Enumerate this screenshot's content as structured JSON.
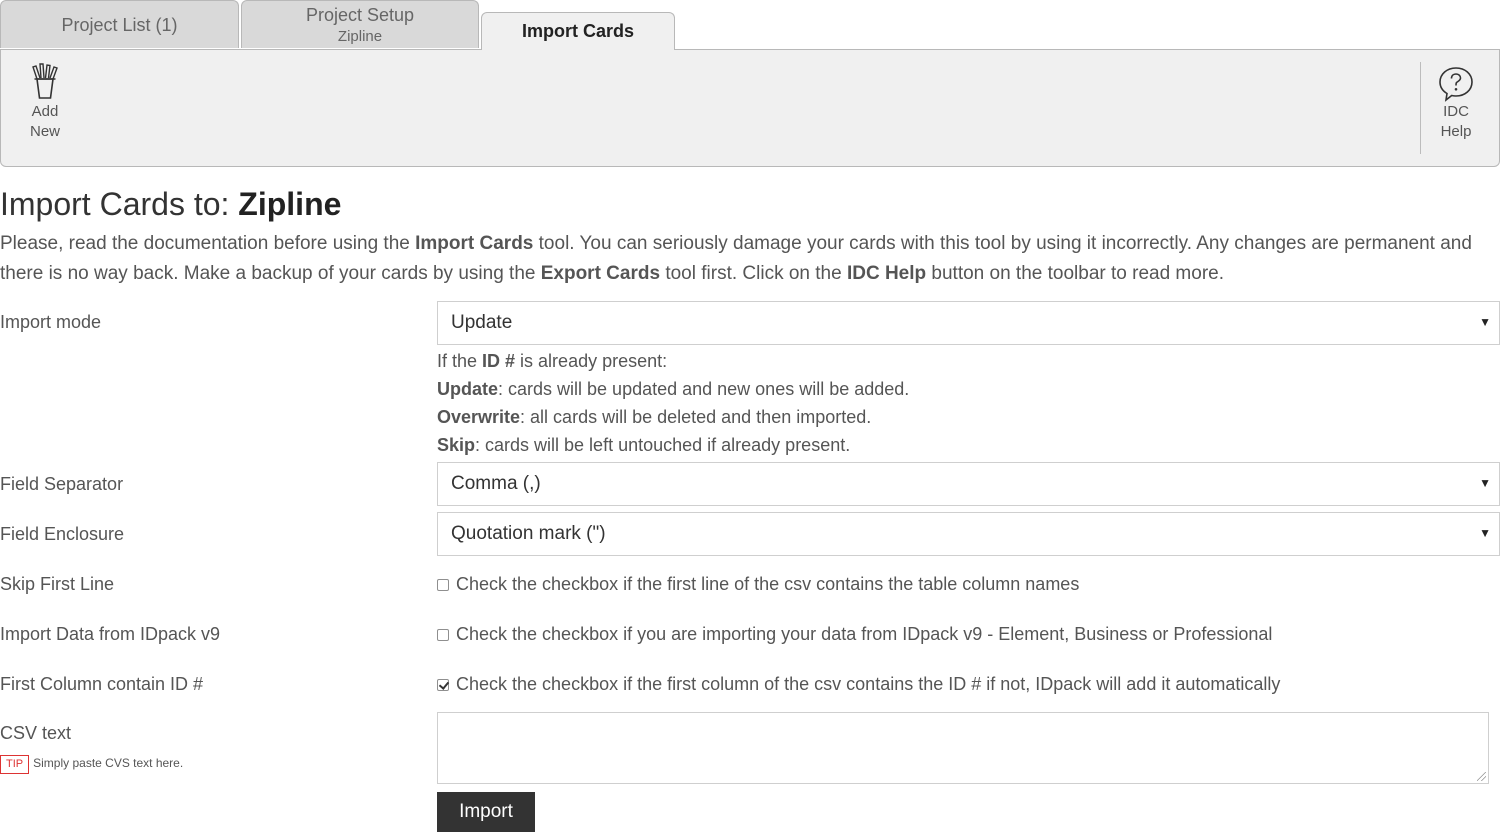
{
  "tabs": [
    {
      "label": "Project List (1)"
    },
    {
      "label": "Project Setup",
      "sublabel": "Zipline"
    },
    {
      "label": "Import Cards"
    }
  ],
  "toolbar": {
    "add_new": {
      "line1": "Add",
      "line2": "New",
      "icon": "pencil-cup-icon"
    },
    "idc_help": {
      "line1": "IDC",
      "line2": "Help",
      "icon": "question-bubble-icon"
    }
  },
  "page": {
    "title_prefix": "Import Cards to: ",
    "project_name": "Zipline",
    "intro": {
      "p1": "Please, read the documentation before using the ",
      "b1": "Import Cards",
      "p2": " tool. You can seriously damage your cards with this tool by using it incorrectly. Any changes are permanent and there is no way back. Make a backup of your cards by using the ",
      "b2": "Export Cards",
      "p3": " tool first. Click on the ",
      "b3": "IDC Help",
      "p4": " button on the toolbar to read more."
    }
  },
  "form": {
    "import_mode": {
      "label": "Import mode",
      "value": "Update",
      "help": {
        "intro_pre": "If the ",
        "intro_b": "ID #",
        "intro_post": " is already present:",
        "update_b": "Update",
        "update_t": ": cards will be updated and new ones will be added.",
        "overwrite_b": "Overwrite",
        "overwrite_t": ": all cards will be deleted and then imported.",
        "skip_b": "Skip",
        "skip_t": ": cards will be left untouched if already present."
      }
    },
    "field_separator": {
      "label": "Field Separator",
      "value": "Comma (,)"
    },
    "field_enclosure": {
      "label": "Field Enclosure",
      "value": "Quotation mark (\")"
    },
    "skip_first_line": {
      "label": "Skip First Line",
      "text": "Check the checkbox if the first line of the csv contains the table column names",
      "checked": false
    },
    "import_idpack": {
      "label": "Import Data from IDpack v9",
      "text": "Check the checkbox if you are importing your data from IDpack v9 - Element, Business or Professional",
      "checked": false
    },
    "first_column_id": {
      "label": "First Column contain ID #",
      "text": "Check the checkbox if the first column of the csv contains the ID # if not, IDpack will add it automatically",
      "checked": true
    },
    "csv_text": {
      "label": "CSV text",
      "value": "",
      "tip_badge": "TIP",
      "tip_text": "Simply paste CVS text here."
    },
    "import_button": "Import"
  }
}
